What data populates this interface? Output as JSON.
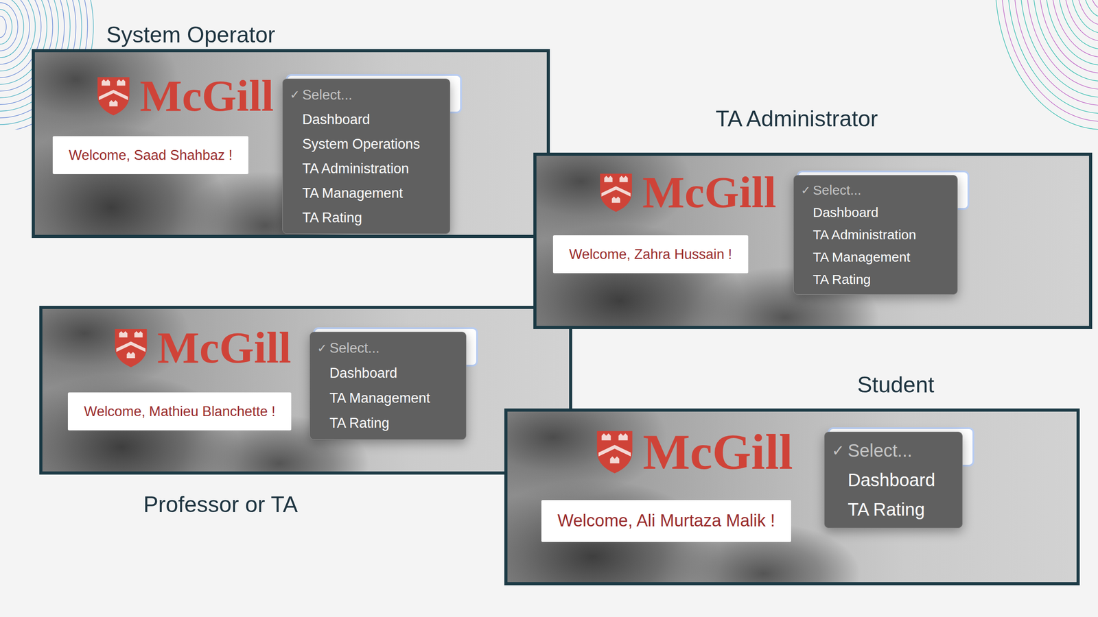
{
  "panels": [
    {
      "role": "System Operator",
      "logo": "McGill",
      "welcome": "Welcome, Saad Shahbaz !",
      "menu": {
        "mark": "✓",
        "items": [
          {
            "label": "Select...",
            "selected": true,
            "disabled": true
          },
          {
            "label": "Dashboard",
            "selected": false,
            "disabled": false
          },
          {
            "label": "System Operations",
            "selected": false,
            "disabled": false
          },
          {
            "label": "TA Administration",
            "selected": false,
            "disabled": false
          },
          {
            "label": "TA Management",
            "selected": false,
            "disabled": false
          },
          {
            "label": "TA Rating",
            "selected": false,
            "disabled": false
          }
        ]
      }
    },
    {
      "role": "TA Administrator",
      "logo": "McGill",
      "welcome": "Welcome, Zahra Hussain !",
      "menu": {
        "mark": "✓",
        "items": [
          {
            "label": "Select...",
            "selected": true,
            "disabled": true
          },
          {
            "label": "Dashboard",
            "selected": false,
            "disabled": false
          },
          {
            "label": "TA Administration",
            "selected": false,
            "disabled": false
          },
          {
            "label": "TA Management",
            "selected": false,
            "disabled": false
          },
          {
            "label": "TA Rating",
            "selected": false,
            "disabled": false
          }
        ]
      }
    },
    {
      "role": "Professor or TA",
      "logo": "McGill",
      "welcome": "Welcome, Mathieu Blanchette !",
      "menu": {
        "mark": "✓",
        "items": [
          {
            "label": "Select...",
            "selected": true,
            "disabled": true
          },
          {
            "label": "Dashboard",
            "selected": false,
            "disabled": false
          },
          {
            "label": "TA Management",
            "selected": false,
            "disabled": false
          },
          {
            "label": "TA Rating",
            "selected": false,
            "disabled": false
          }
        ]
      }
    },
    {
      "role": "Student",
      "logo": "McGill",
      "welcome": "Welcome, Ali Murtaza Malik !",
      "menu": {
        "mark": "✓",
        "items": [
          {
            "label": "Select...",
            "selected": true,
            "disabled": true
          },
          {
            "label": "Dashboard",
            "selected": false,
            "disabled": false
          },
          {
            "label": "TA Rating",
            "selected": false,
            "disabled": false
          }
        ]
      }
    }
  ]
}
